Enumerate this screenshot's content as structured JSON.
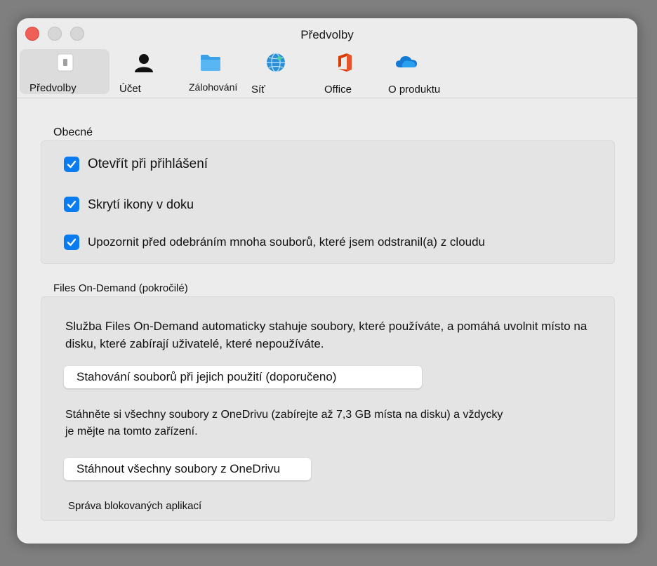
{
  "window": {
    "title": "Předvolby"
  },
  "tabs": [
    {
      "label": "Předvolby",
      "icon": "switch-icon",
      "selected": true
    },
    {
      "label": "Účet",
      "icon": "person-icon"
    },
    {
      "label": "Zálohování",
      "icon": "folder-icon"
    },
    {
      "label": "Síť",
      "icon": "globe-icon"
    },
    {
      "label": "Office",
      "icon": "office-icon"
    },
    {
      "label": "O produktu",
      "icon": "cloud-icon"
    }
  ],
  "general": {
    "title": "Obecné",
    "options": [
      {
        "label": "Otevřít při přihlášení",
        "checked": true
      },
      {
        "label": "Skrytí ikony v doku",
        "checked": true
      },
      {
        "label": "Upozornit před odebráním mnoha souborů, které jsem odstranil(a) z cloudu",
        "checked": true
      }
    ]
  },
  "fod": {
    "title": "Files On-Demand (pokročilé)",
    "description_line1": "Služba Files On-Demand automaticky stahuje soubory, které používáte, a pomáhá uvolnit místo na",
    "description_line2": "disku, které zabírají uživatelé, které nepoužíváte.",
    "download_on_use_button": "Stahování souborů při jejich použití (doporučeno)",
    "download_all_text_line1": "Stáhněte si všechny soubory z OneDrivu (zabírejte až 7,3 GB místa na disku) a vždycky",
    "download_all_text_line2": "je mějte na tomto zařízení.",
    "download_all_button": "Stáhnout všechny soubory z OneDrivu",
    "blocked_apps_link": "Správa blokovaných aplikací"
  },
  "colors": {
    "accent": "#0a7cf0",
    "window_bg": "#ececec",
    "panel_bg": "#e4e4e4",
    "close": "#ee5f57"
  }
}
